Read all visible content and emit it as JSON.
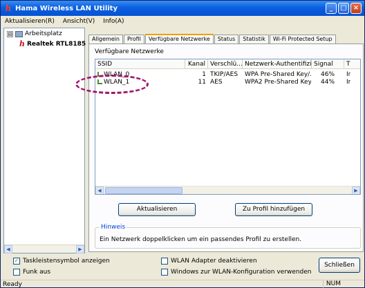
{
  "window": {
    "title": "Hama Wireless LAN Utility",
    "controls": {
      "minimize": "_",
      "maximize": "□",
      "close": "×"
    }
  },
  "menu": [
    "Aktualisieren(R)",
    "Ansicht(V)",
    "Info(A)"
  ],
  "tree": {
    "root": {
      "expander": "⊟",
      "label": "Arbeitsplatz"
    },
    "adapter": {
      "icon": "h",
      "label": "Realtek RTL8185"
    }
  },
  "tabs": [
    "Allgemein",
    "Profil",
    "Verfügbare Netzwerke",
    "Status",
    "Statistik",
    "Wi-Fi Protected Setup"
  ],
  "active_tab_index": 2,
  "panel": {
    "heading": "Verfügbare Netzwerke",
    "columns": [
      "SSID",
      "Kanal",
      "Verschlü...",
      "Netzwerk-Authentifizi...",
      "Signal",
      "T"
    ],
    "rows": [
      {
        "ssid": "WLAN_0",
        "channel": "1",
        "encryption": "TKIP/AES",
        "auth": "WPA Pre-Shared Key/...",
        "signal": "46%",
        "type": "Ir"
      },
      {
        "ssid": "WLAN_1",
        "channel": "11",
        "encryption": "AES",
        "auth": "WPA2 Pre-Shared Key",
        "signal": "44%",
        "type": "Ir"
      }
    ],
    "refresh_button": "Aktualisieren",
    "add_profile_button": "Zu Profil hinzufügen",
    "hint_legend": "Hinweis",
    "hint_text": "Ein Netzwerk doppelklicken um ein passendes Profil zu erstellen."
  },
  "options": {
    "tray_icon": {
      "label": "Taskleistensymbol anzeigen",
      "checked": true
    },
    "radio_off": {
      "label": "Funk aus",
      "checked": false
    },
    "disable_adapter": {
      "label": "WLAN Adapter deaktivieren",
      "checked": false
    },
    "use_windows": {
      "label": "Windows zur WLAN-Konfiguration verwenden",
      "checked": false
    }
  },
  "close_button": "Schließen",
  "status": {
    "text": "Ready",
    "num": "NUM"
  },
  "scroll_arrows": {
    "left": "◀",
    "right": "▶"
  },
  "colors": {
    "annotation": "#a0186b",
    "titlebar": "#0a5fe0",
    "hint_legend": "#0046d5"
  }
}
